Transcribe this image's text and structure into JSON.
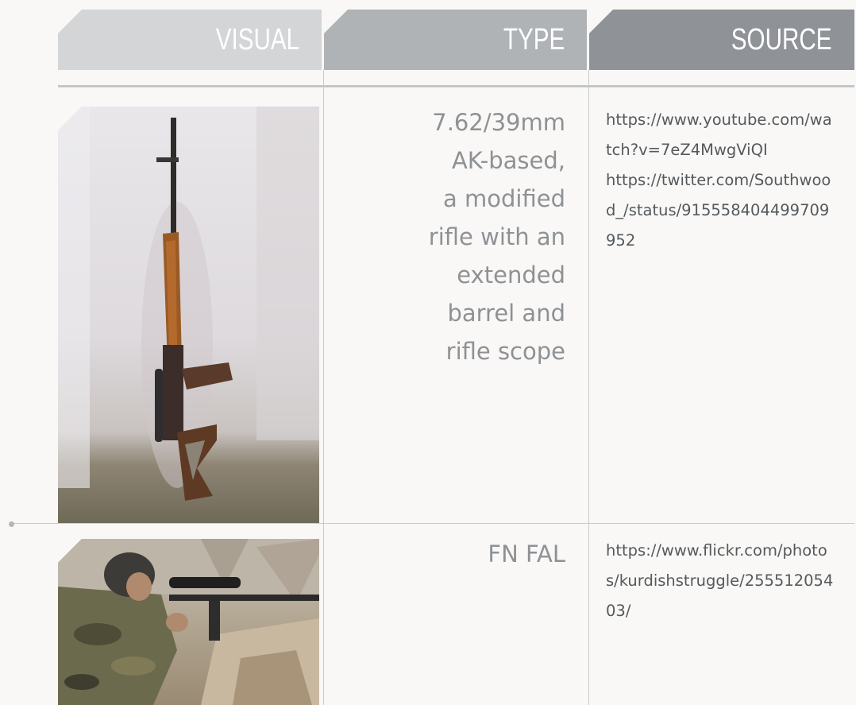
{
  "headers": {
    "visual": "VISUAL",
    "type": "TYPE",
    "source": "SOURCE"
  },
  "colors": {
    "header_visual": "#d4d5d6",
    "header_type": "#b0b3b6",
    "header_source": "#8f9397",
    "type_text": "#8e9195",
    "source_text": "#55595d"
  },
  "rows": [
    {
      "image": "rifle-leaning-against-wall-photo",
      "type_lines": [
        "7.62/39mm",
        "AK-based,",
        "a modified",
        "rifle with an",
        "extended",
        "barrel and",
        "rifle scope"
      ],
      "source_lines": [
        "https://www.youtube.com/wa",
        "tch?v=7eZ4MwgViQI",
        "https://twitter.com/Southwoo",
        "d_/status/915558404499709",
        "952"
      ]
    },
    {
      "image": "fighter-aiming-scoped-rifle-photo",
      "type_lines": [
        "FN FAL"
      ],
      "source_lines": [
        "https://www.flickr.com/photo",
        "s/kurdishstruggle/255512054",
        "03/"
      ]
    }
  ]
}
